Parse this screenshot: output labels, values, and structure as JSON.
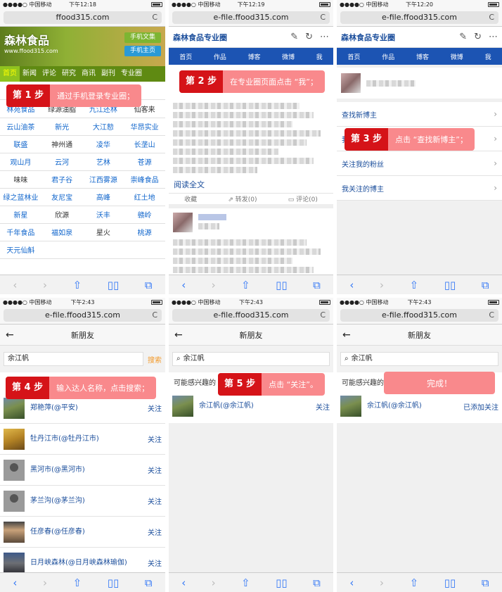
{
  "common": {
    "carrier": "●●●●○ 中国移动",
    "url_main": "ffood315.com",
    "url_file": "e-file.ffood315.com",
    "reload": "C",
    "back": "‹",
    "forward": "›",
    "share": "⇧",
    "book": "▯▯",
    "tabs": "⧉",
    "follow": "关注"
  },
  "p1": {
    "time": "下午12:18",
    "logo": "森林食品",
    "logo_url": "www.ffood315.com",
    "btn_articles": "手机文集",
    "btn_home": "手机主页",
    "nav": [
      "首页",
      "新闻",
      "评论",
      "研究",
      "商讯",
      "副刊",
      "专业圈"
    ],
    "rows": [
      [
        "林苑食品",
        "绿源油脂",
        "九江还林",
        "仙客来"
      ],
      [
        "云山油茶",
        "新光",
        "大江愸",
        "华昂实业"
      ],
      [
        "联盛",
        "神州通",
        "凌华",
        "长垄山"
      ],
      [
        "观山月",
        "云河",
        "艺林",
        "苍源"
      ],
      [
        "味味",
        "君子谷",
        "江西雾源",
        "崇峰食品"
      ],
      [
        "绿之蓝林业",
        "友尼宝",
        "高峰",
        "红土地"
      ],
      [
        "新星",
        "欣源",
        "沃丰",
        "赣岭"
      ],
      [
        "千年食品",
        "福如泉",
        "星火",
        "桃源"
      ],
      [
        "天元仙斛",
        "",
        "",
        ""
      ]
    ],
    "step_num": "第 1 步",
    "step_text": "通过手机登录专业圈；"
  },
  "p2": {
    "time": "下午12:19",
    "title": "森林食品专业圈",
    "nav": [
      "首页",
      "作品",
      "博客",
      "微博",
      "我"
    ],
    "read_more": "阅读全文",
    "fav": "收藏",
    "forward": "转发(0)",
    "comment": "评论(0)",
    "step_num": "第 2 步",
    "step_text": "在专业圈页面点击 “我”；"
  },
  "p3": {
    "time": "下午12:20",
    "title": "森林食品专业圈",
    "nav": [
      "首页",
      "作品",
      "博客",
      "微博",
      "我"
    ],
    "rows": [
      "查找新博主",
      "我",
      "关注我的粉丝",
      "我关注的博主"
    ],
    "step_num": "第 3 步",
    "step_text": "点击 “查找新博主”；"
  },
  "p4": {
    "time": "下午2:43",
    "title": "新朋友",
    "query": "余江帆",
    "search": "搜索",
    "friends": [
      "郑艳萍(@平安)",
      "牡丹江市(@牡丹江市)",
      "黑河市(@黑河市)",
      "茅兰沟(@茅兰沟)",
      "任彦春(@任彦春)",
      "日月峡森林(@日月峡森林瑜伽)"
    ],
    "step_num": "第 4 步",
    "step_text": "输入达人名称，点击搜索；"
  },
  "p5": {
    "time": "下午2:43",
    "title": "新朋友",
    "query": "余江帆",
    "intro": "可能感兴趣的",
    "result": "余江帆(@余江帆)",
    "step_num": "第 5 步",
    "step_text": "点击 “关注”。"
  },
  "p6": {
    "time": "下午2:43",
    "title": "新朋友",
    "query": "余江帆",
    "intro": "可能感兴趣的",
    "result": "余江帆(@余江帆)",
    "added": "已添加关注",
    "done": "完成！"
  },
  "colors": {
    "accent_red": "#d51318",
    "step_pink": "#f9898c",
    "blog_blue": "#1c54b3",
    "forest_green": "#5f8a12"
  }
}
